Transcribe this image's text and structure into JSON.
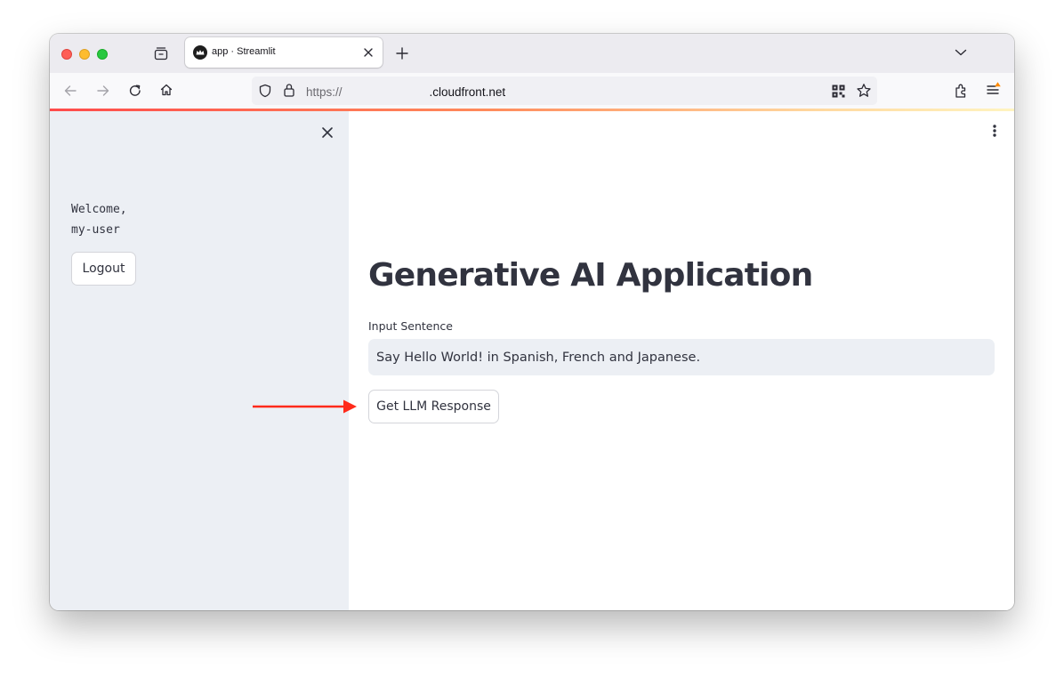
{
  "browser": {
    "tab_title": "app · Streamlit",
    "url_scheme": "https://",
    "url_visible": ".cloudfront.net",
    "icons": [
      "tab-list-icon",
      "close-tab-icon",
      "new-tab-icon",
      "tab-overflow-chevron-icon",
      "back-icon",
      "forward-icon",
      "reload-icon",
      "home-icon",
      "shield-icon",
      "lock-icon",
      "qr-code-icon",
      "bookmark-star-icon",
      "extensions-icon",
      "app-menu-icon"
    ]
  },
  "sidebar": {
    "welcome_text": "Welcome,\nmy-user",
    "logout_label": "Logout",
    "close_icon": "close-icon"
  },
  "main": {
    "title": "Generative AI Application",
    "input_label": "Input Sentence",
    "input_value": "Say Hello World! in Spanish, French and Japanese.",
    "submit_label": "Get LLM Response",
    "menu_icon": "kebab-menu-icon"
  },
  "annotation": {
    "arrow_color": "#ff2a1a"
  },
  "colors": {
    "sidebar_bg": "#eceff4",
    "text": "#31333f",
    "accent": "#ff4b4b"
  }
}
